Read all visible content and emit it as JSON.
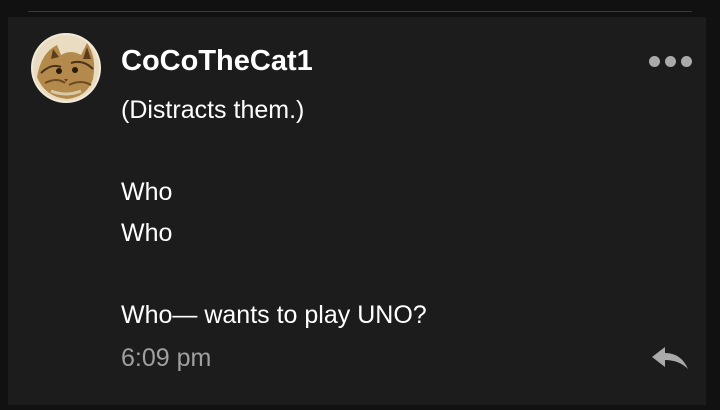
{
  "post": {
    "username": "CoCoTheCat1",
    "lines": [
      "(Distracts them.)",
      "",
      "Who",
      "Who",
      "",
      "Who— wants to play UNO?"
    ],
    "timestamp": "6:09 pm"
  },
  "icons": {
    "more": "more-options-icon",
    "reply": "reply-icon"
  },
  "colors": {
    "background": "#111111",
    "card": "#1c1c1c",
    "text": "#ffffff",
    "muted": "#a0a0a0",
    "icon": "#aaaaaa"
  }
}
